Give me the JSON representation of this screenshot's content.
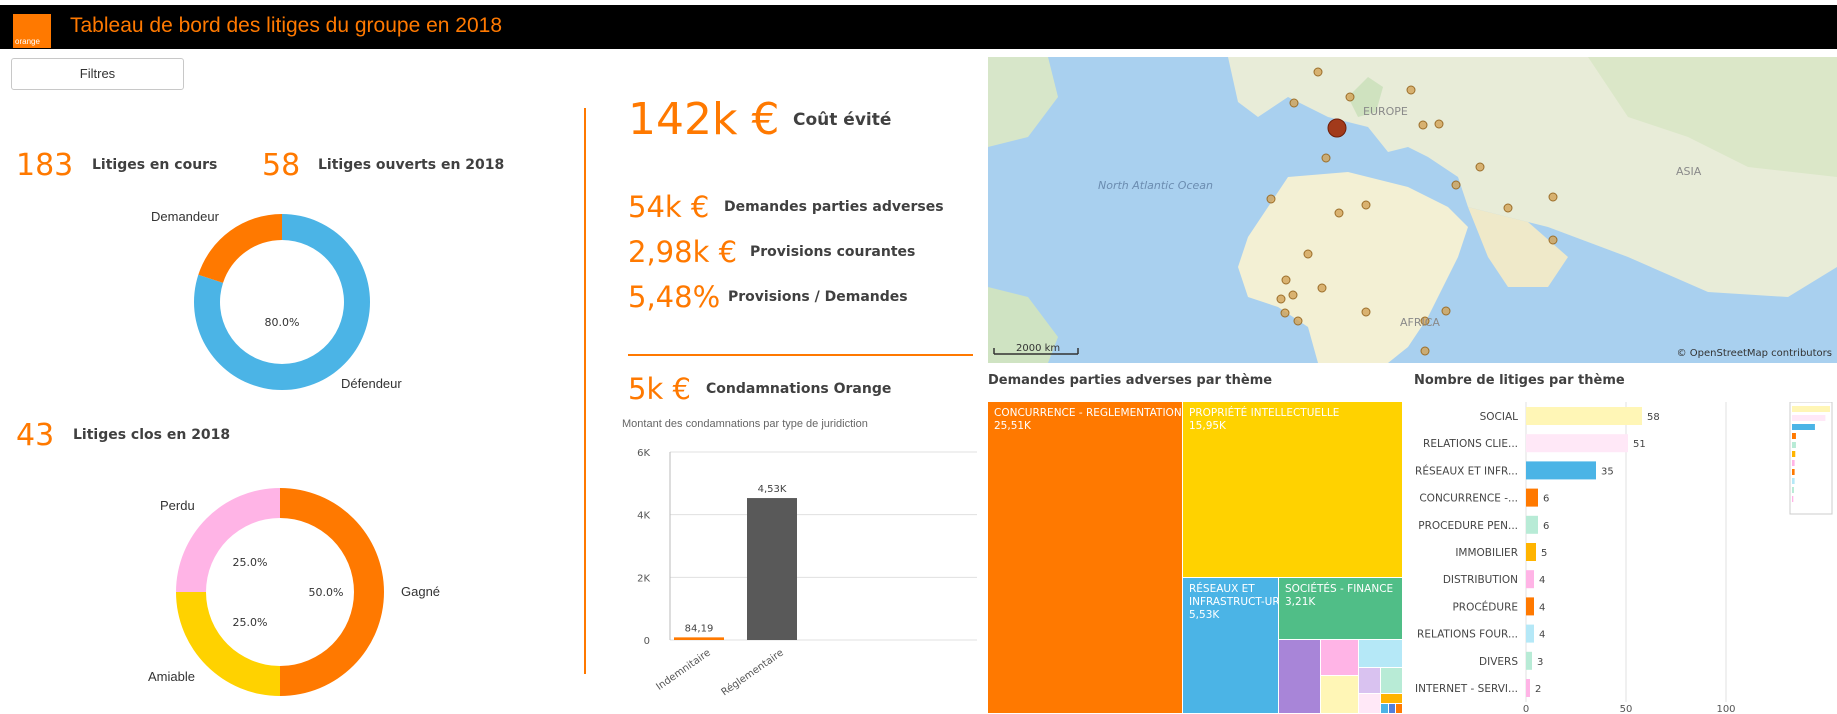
{
  "app": {
    "logo_text": "orange",
    "title": "Tableau de bord des litiges du groupe en 2018",
    "brand_color": "#ff7900"
  },
  "filters": {
    "label": "Filtres"
  },
  "kpis": {
    "litiges_en_cours": {
      "value": "183",
      "label": "Litiges en cours"
    },
    "litiges_ouverts": {
      "value": "58",
      "label": "Litiges ouverts en 2018"
    },
    "litiges_clos": {
      "value": "43",
      "label": "Litiges clos en 2018"
    },
    "cout_evite": {
      "value": "142k €",
      "label": "Coût évité"
    },
    "demandes": {
      "value": "54k €",
      "label": "Demandes parties adverses"
    },
    "provisions": {
      "value": "2,98k €",
      "label": "Provisions courantes"
    },
    "ratio": {
      "value": "5,48%",
      "label": "Provisions / Demandes"
    },
    "condamnations": {
      "value": "5k €",
      "label": "Condamnations Orange"
    }
  },
  "donut_roles": {
    "center_text": "80.0%",
    "segments": [
      {
        "label": "Demandeur",
        "share": 0.2,
        "color": "#ff7900"
      },
      {
        "label": "Défendeur",
        "share": 0.8,
        "color": "#4bb4e6"
      }
    ]
  },
  "donut_outcome": {
    "segments": [
      {
        "label": "Gagné",
        "share": 0.5,
        "pct": "50.0%",
        "color": "#ff7900"
      },
      {
        "label": "Amiable",
        "share": 0.25,
        "pct": "25.0%",
        "color": "#ffd200"
      },
      {
        "label": "Perdu",
        "share": 0.25,
        "pct": "25.0%",
        "color": "#ffb4e6"
      }
    ]
  },
  "map": {
    "ocean_label": "North Atlantic Ocean",
    "labels": {
      "europe": "EUROPE",
      "asia": "ASIA",
      "africa": "AFRICA"
    },
    "scale": "2000 km",
    "attribution": "© OpenStreetMap contributors"
  },
  "chart_data": [
    {
      "type": "bar",
      "title": "Montant des condamnations par type de juridiction",
      "categories": [
        "Indemnitaire",
        "Réglementaire"
      ],
      "values": [
        84.19,
        4530
      ],
      "data_labels": [
        "84,19",
        "4,53K"
      ],
      "colors": [
        "#ff7900",
        "#595959"
      ],
      "ylim": [
        0,
        6000
      ],
      "yticks": [
        0,
        2000,
        4000,
        6000
      ],
      "ytick_labels": [
        "0",
        "2K",
        "4K",
        "6K"
      ],
      "grid": true
    },
    {
      "type": "treemap",
      "title": "Demandes parties adverses par thème",
      "items": [
        {
          "name": "CONCURRENCE - REGLEMENTATION",
          "value_label": "25,51K",
          "color": "#ff7900"
        },
        {
          "name": "PROPRIÉTÉ INTELLECTUELLE",
          "value_label": "15,95K",
          "color": "#ffd200"
        },
        {
          "name": "RÉSEAUX ET INFRASTRUCT-URES",
          "value_label": "5,53K",
          "color": "#4bb4e6"
        },
        {
          "name": "SOCIÉTÉS - FINANCE",
          "value_label": "3,21K",
          "color": "#50be87"
        }
      ]
    },
    {
      "type": "bar",
      "orientation": "horizontal",
      "title": "Nombre de litiges par thème",
      "categories": [
        "SOCIAL",
        "RELATIONS CLIE...",
        "RÉSEAUX ET INFR...",
        "CONCURRENCE -...",
        "PROCEDURE PEN...",
        "IMMOBILIER",
        "DISTRIBUTION",
        "PROCÉDURE",
        "RELATIONS FOUR...",
        "DIVERS",
        "INTERNET - SERVI..."
      ],
      "values": [
        58,
        51,
        35,
        6,
        6,
        5,
        4,
        4,
        4,
        3,
        2
      ],
      "colors": [
        "#fff6b6",
        "#ffe8f7",
        "#4bb4e6",
        "#ff7900",
        "#b8ebd6",
        "#ffb400",
        "#ffb4e6",
        "#ff7900",
        "#b5e8f7",
        "#b8ebd6",
        "#ffb4e6"
      ],
      "xlim": [
        0,
        100
      ],
      "xticks": [
        0,
        50,
        100
      ]
    }
  ]
}
